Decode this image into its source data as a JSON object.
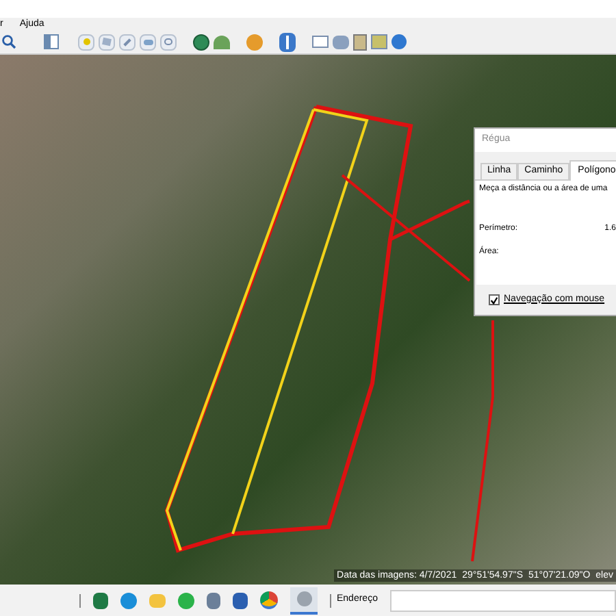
{
  "menu_bar": {
    "items": [
      "r",
      "Ajuda"
    ]
  },
  "status_overlay": {
    "imagery_date": "Data das imagens: 4/7/2021",
    "latitude": "29°51'54.97\"S",
    "longitude": "51°07'21.09\"O",
    "elevation": "elev"
  },
  "ruler_dialog": {
    "title": "Régua",
    "tabs": [
      {
        "label": "Linha",
        "selected": false
      },
      {
        "label": "Caminho",
        "selected": false
      },
      {
        "label": "Polígono",
        "selected": true
      }
    ],
    "description": "Meça a distância ou a área de uma",
    "fields": [
      {
        "label": "Perímetro:",
        "value": "1.6"
      },
      {
        "label": "Área:"
      }
    ],
    "mouse_navigation": {
      "label": "Navegação com mouse",
      "checked": true
    }
  },
  "taskbar": {
    "address_label": "Endereço"
  }
}
